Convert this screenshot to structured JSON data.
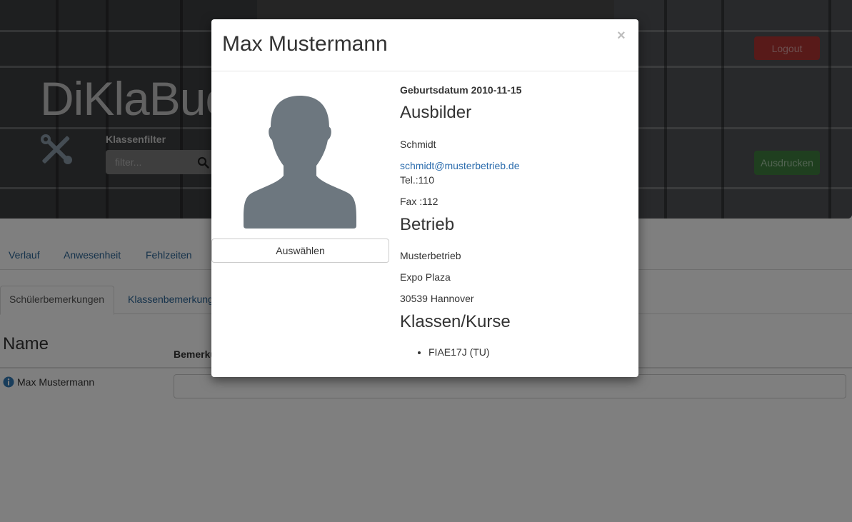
{
  "app": {
    "brand": "DiKlaBuch",
    "filter_label": "Klassenfilter",
    "filter_placeholder": "filter...",
    "logout_label": "Logout",
    "print_label": "Ausdrucken"
  },
  "nav": {
    "tabs": [
      {
        "label": "Verlauf"
      },
      {
        "label": "Anwesenheit"
      },
      {
        "label": "Fehlzeiten"
      }
    ]
  },
  "subnav": {
    "tabs": [
      {
        "label": "Schülerbemerkungen",
        "active": true
      },
      {
        "label": "Klassenbemerkungen"
      }
    ]
  },
  "table": {
    "headers": [
      "Name",
      "Bemerkung"
    ],
    "rows": [
      {
        "name": "Max Mustermann",
        "bemerkung": ""
      }
    ]
  },
  "modal": {
    "title": "Max Mustermann",
    "close_glyph": "×",
    "select_label": "Auswählen",
    "birthdate_label": "Geburtsdatum 2010-11-15",
    "ausbilder": {
      "heading": "Ausbilder",
      "name": "Schmidt",
      "email": "schmidt@musterbetrieb.de",
      "tel": "Tel.:110",
      "fax": "Fax :112"
    },
    "betrieb": {
      "heading": "Betrieb",
      "name": "Musterbetrieb",
      "street": "Expo Plaza",
      "city": "30539 Hannover"
    },
    "klassen": {
      "heading": "Klassen/Kurse",
      "items": [
        "FIAE17J (TU)"
      ]
    }
  },
  "colors": {
    "link": "#337ab7",
    "danger": "#d9534f",
    "success": "#5cb85c",
    "avatar": "#6d777f"
  },
  "icons": {
    "tools": "tools-icon",
    "search": "search-icon",
    "info": "info-circle-icon",
    "avatar": "user-silhouette-icon",
    "close": "close-icon"
  }
}
